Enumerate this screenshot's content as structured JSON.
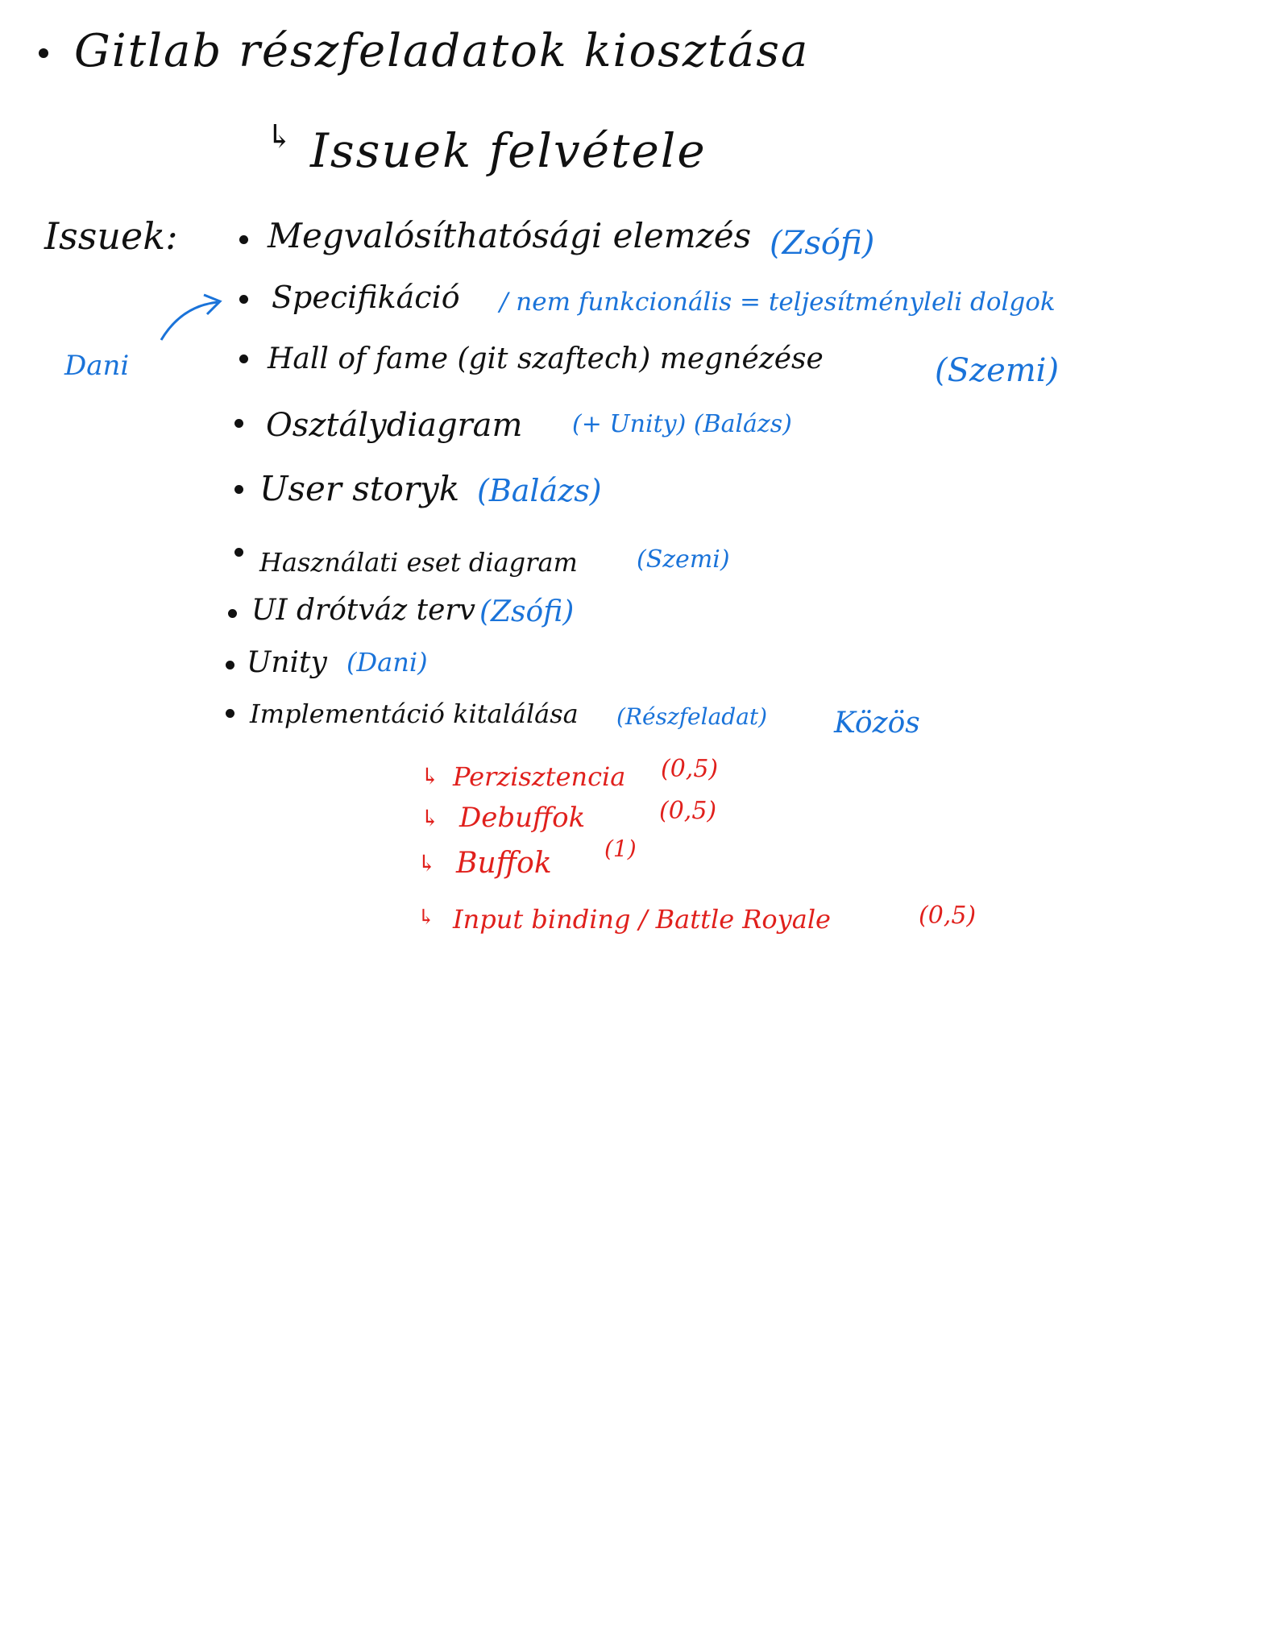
{
  "heading": {
    "title": "Gitlab részfeladatok kiosztása",
    "subtitle": "Issuek felvétele"
  },
  "issues_label": "Issuek:",
  "assignee_side": "Dani",
  "items": [
    {
      "text": "Megvalósíthatósági elemzés",
      "assignee": "(Zsófi)"
    },
    {
      "text": "Specifikáció",
      "assignee": "/ nem funkcionális = teljesítményleli dolgok"
    },
    {
      "text": "Hall of fame (git szaftech) megnézése",
      "assignee": "(Szemi)"
    },
    {
      "text": "Osztálydiagram",
      "assignee": "(+ Unity) (Balázs)"
    },
    {
      "text": "User storyk",
      "assignee": "(Balázs)"
    },
    {
      "text": "Használati eset diagram",
      "assignee": "(Szemi)"
    },
    {
      "text": "UI drótváz terv",
      "assignee": "(Zsófi)"
    },
    {
      "text": "Unity",
      "assignee": "(Dani)"
    },
    {
      "text": "Implementáció kitalálása",
      "assignee": "(Részfeladat)",
      "extra": "Közös"
    }
  ],
  "subtasks": [
    {
      "text": "Perzisztencia",
      "weight": "(0,5)"
    },
    {
      "text": "Debuffok",
      "weight": "(0,5)"
    },
    {
      "text": "Buffok",
      "weight": "(1)"
    },
    {
      "text": "Input binding / Battle Royale",
      "weight": "(0,5)"
    }
  ],
  "colors": {
    "black": "#111111",
    "blue": "#1a73d9",
    "red": "#e0201c"
  }
}
